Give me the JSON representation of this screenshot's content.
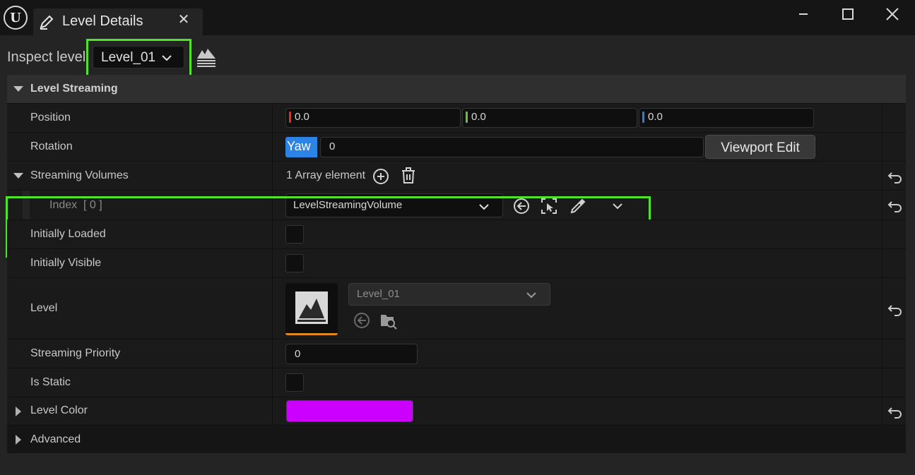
{
  "window": {
    "logo_letter": "U",
    "tab_title": "Level Details",
    "tab_close": "✕"
  },
  "toolbar": {
    "inspect_label": "Inspect level",
    "level_selected": "Level_01"
  },
  "section": {
    "title": "Level Streaming"
  },
  "properties": {
    "position": {
      "label": "Position",
      "x": "0.0",
      "y": "0.0",
      "z": "0.0"
    },
    "rotation": {
      "label": "Rotation",
      "axis": "Yaw",
      "value": "0",
      "viewport_button": "Viewport Edit"
    },
    "streaming_volumes": {
      "label": "Streaming Volumes",
      "count_text": "1 Array element"
    },
    "index0": {
      "label_prefix": "Index",
      "label_index": "[ 0 ]",
      "value": "LevelStreamingVolume"
    },
    "initially_loaded": {
      "label": "Initially Loaded",
      "checked": false
    },
    "initially_visible": {
      "label": "Initially Visible",
      "checked": false
    },
    "level": {
      "label": "Level",
      "value": "Level_01"
    },
    "streaming_priority": {
      "label": "Streaming Priority",
      "value": "0"
    },
    "is_static": {
      "label": "Is Static",
      "checked": false
    },
    "level_color": {
      "label": "Level Color",
      "color": "#cc00ff"
    },
    "advanced": {
      "label": "Advanced"
    }
  },
  "colors": {
    "highlight": "#4ee42a",
    "axis_x": "#e0321e",
    "axis_y": "#6ac23a",
    "axis_z": "#2e7de0",
    "yaw_accent": "#2c84e6"
  }
}
